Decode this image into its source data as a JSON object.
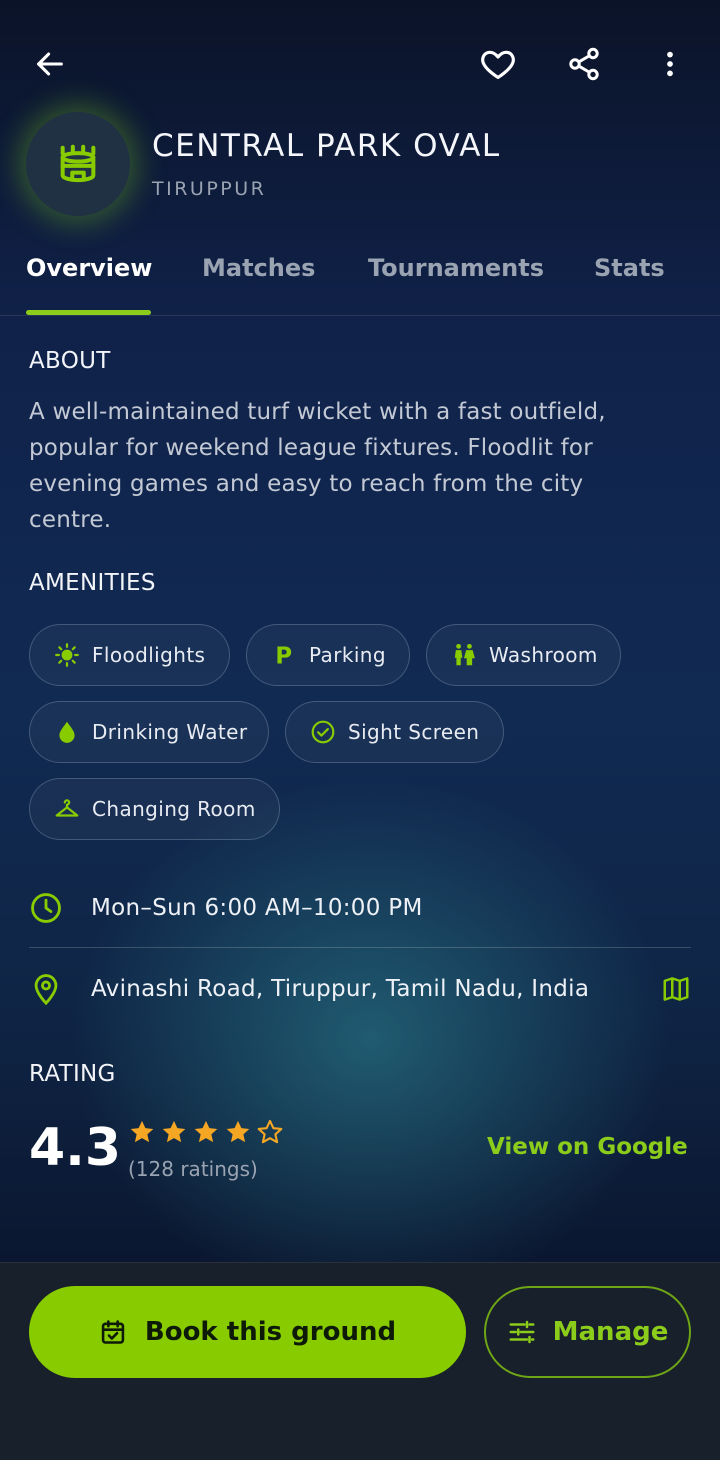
{
  "header": {
    "icons": [
      "back-arrow-icon",
      "heart-icon",
      "share-icon",
      "more-vertical-icon"
    ]
  },
  "ground": {
    "name": "CENTRAL PARK OVAL",
    "city": "TIRUPPUR",
    "icon": "stadium-icon",
    "accent_color": "#88cc00"
  },
  "tabs": [
    {
      "label": "Overview",
      "active": true
    },
    {
      "label": "Matches",
      "active": false
    },
    {
      "label": "Tournaments",
      "active": false
    },
    {
      "label": "Stats",
      "active": false
    }
  ],
  "about": {
    "heading": "ABOUT",
    "text": "A well-maintained turf wicket with a fast outfield, popular for weekend league fixtures. Floodlit for evening games and easy to reach from the city centre."
  },
  "amenities": {
    "heading": "AMENITIES",
    "items": [
      {
        "label": "Floodlights",
        "icon": "sun-icon"
      },
      {
        "label": "Parking",
        "icon": "parking-icon"
      },
      {
        "label": "Washroom",
        "icon": "restroom-icon"
      },
      {
        "label": "Drinking Water",
        "icon": "water-drop-icon"
      },
      {
        "label": "Sight Screen",
        "icon": "check-circle-icon"
      },
      {
        "label": "Changing Room",
        "icon": "hanger-icon"
      }
    ]
  },
  "hours": {
    "text": "Mon–Sun 6:00 AM–10:00 PM",
    "icon": "clock-icon"
  },
  "location": {
    "text": "Avinashi Road, Tiruppur, Tamil Nadu, India",
    "icon": "pin-icon",
    "map_icon": "map-icon"
  },
  "rating": {
    "heading": "RATING",
    "value": "4.3",
    "stars_filled": 4,
    "stars_total": 5,
    "count_text": "(128 ratings)",
    "google_link": "View on Google",
    "star_color": "#f5a623"
  },
  "actions": {
    "book_label": "Book this ground",
    "manage_label": "Manage"
  }
}
